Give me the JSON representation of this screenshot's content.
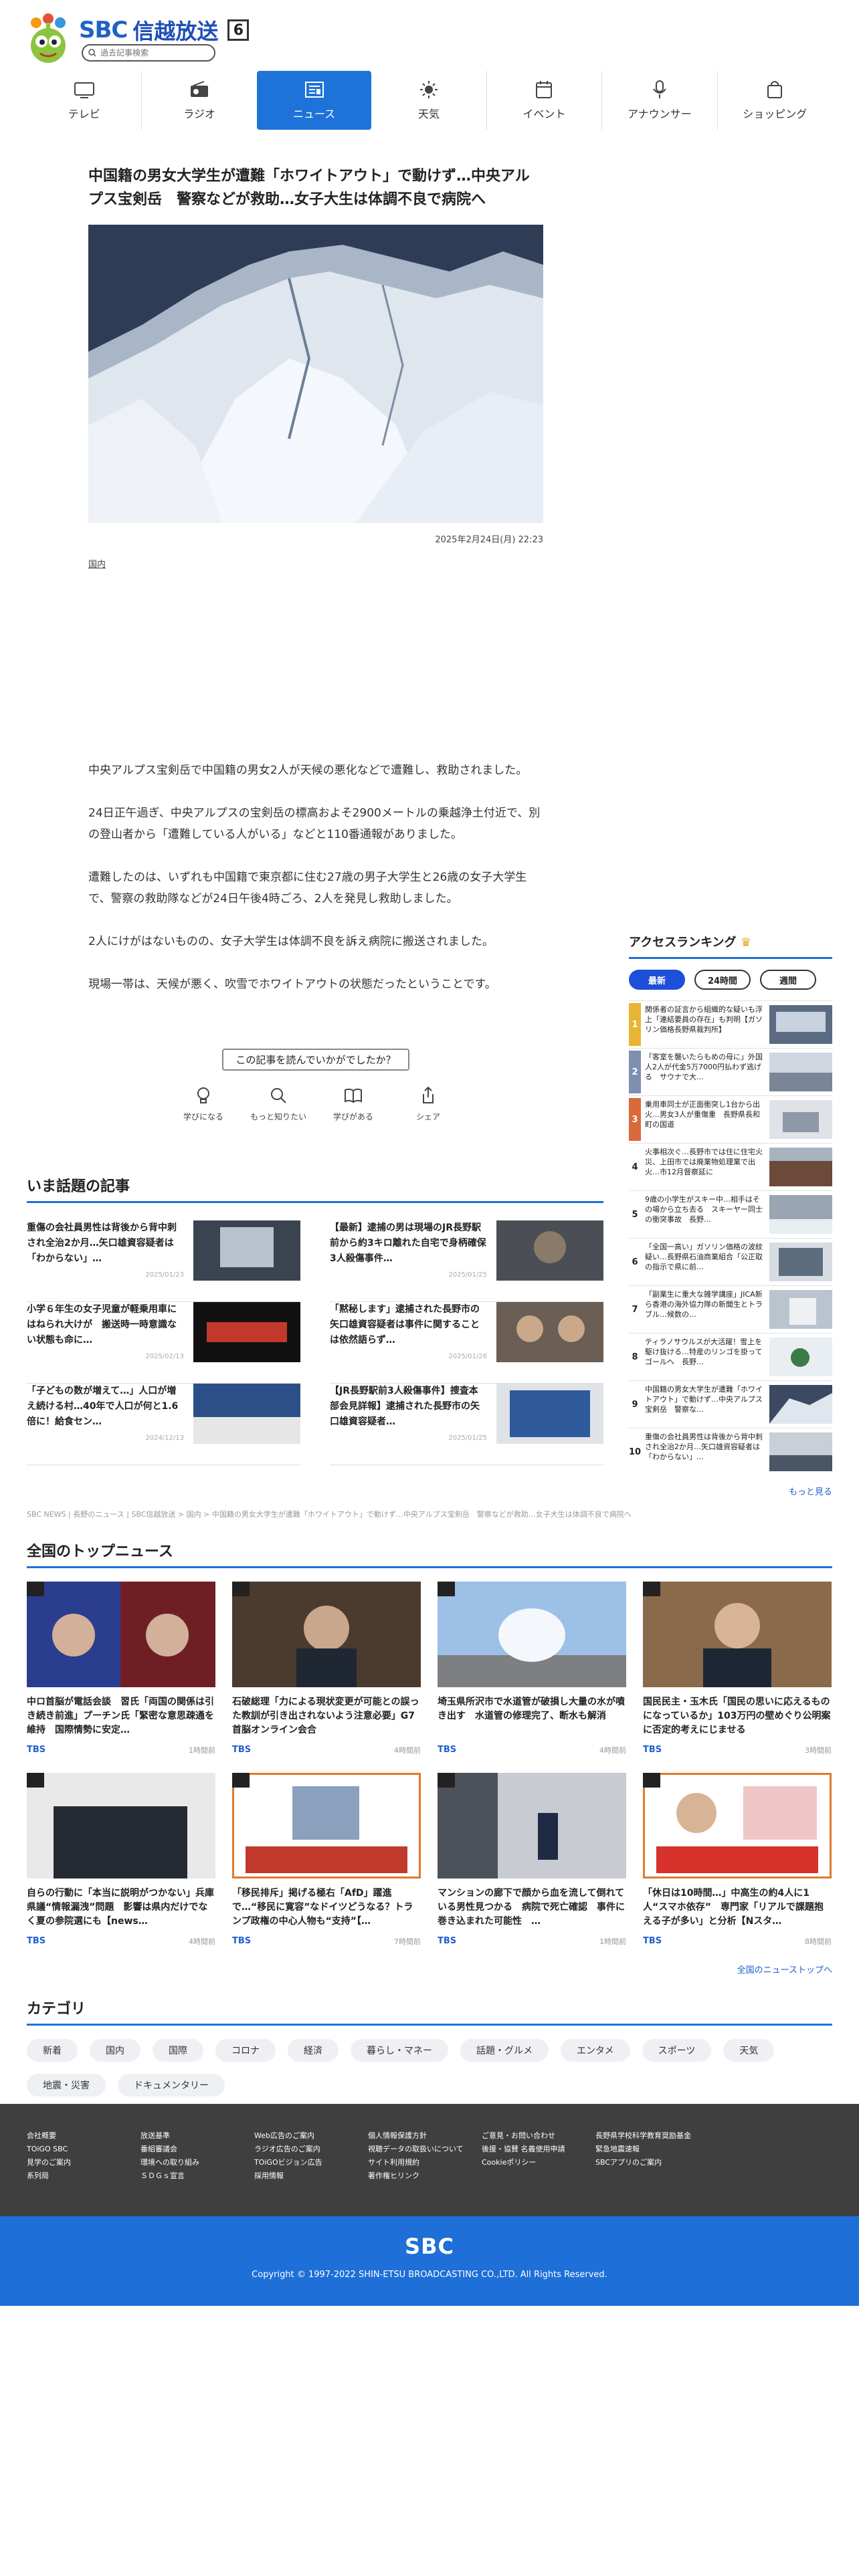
{
  "header": {
    "logo_mark": "SBC",
    "logo_name": "信越放送",
    "channel": "6",
    "search_placeholder": "過去記事検索"
  },
  "nav": [
    {
      "label": "テレビ",
      "icon": "tv-icon"
    },
    {
      "label": "ラジオ",
      "icon": "radio-icon"
    },
    {
      "label": "ニュース",
      "icon": "news-icon",
      "active": true
    },
    {
      "label": "天気",
      "icon": "sun-icon"
    },
    {
      "label": "イベント",
      "icon": "calendar-icon"
    },
    {
      "label": "アナウンサー",
      "icon": "microphone-icon"
    },
    {
      "label": "ショッピング",
      "icon": "shopping-bag-icon"
    }
  ],
  "article": {
    "title": "中国籍の男女大学生が遭難「ホワイトアウト」で動けず…中央アルプス宝剣岳　警察などが救助…女子大生は体調不良で病院へ",
    "date": "2025年2月24日(月) 22:23",
    "category": "国内",
    "paragraphs": [
      "中央アルプス宝剣岳で中国籍の男女2人が天候の悪化などで遭難し、救助されました。",
      "24日正午過ぎ、中央アルプスの宝剣岳の標高およそ2900メートルの乗越浄土付近で、別の登山者から「遭難している人がいる」などと110番通報がありました。",
      "遭難したのは、いずれも中国籍で東京都に住む27歳の男子大学生と26歳の女子大学生で、警察の救助隊などが24日午後4時ごろ、2人を発見し救助しました。",
      "2人にけがはないものの、女子大学生は体調不良を訴え病院に搬送されました。",
      "現場一帯は、天候が悪く、吹雪でホワイトアウトの状態だったということです。"
    ]
  },
  "feedback": {
    "question": "この記事を読んでいかがでしたか？",
    "reactions": [
      {
        "label": "学びになる",
        "icon": "lightbulb-icon"
      },
      {
        "label": "もっと知りたい",
        "icon": "magnifier-icon"
      },
      {
        "label": "学びがある",
        "icon": "book-icon"
      },
      {
        "label": "シェア",
        "icon": "share-icon"
      }
    ]
  },
  "ranking": {
    "title": "アクセスランキング",
    "tabs": [
      "最新",
      "24時間",
      "週間"
    ],
    "items": [
      {
        "num": "1",
        "text": "関係者の証言から組織的な疑いも浮上「連結要員の存在」も判明【ガソリン価格長野県裁判所】"
      },
      {
        "num": "2",
        "text": "「客室を襲いたらもめの母に」外国人2人が代金5万7000円払わず逃げる　サウナで大…"
      },
      {
        "num": "3",
        "text": "乗用車同士が正面衝突し1台から出火…男女3人が重傷重　長野県長和町の国道"
      },
      {
        "num": "4",
        "text": "火事相次ぐ…長野市では住に住宅火災、上田市では廃業物処理業で出火…市12月督察延に"
      },
      {
        "num": "5",
        "text": "9歳の小学生がスキー中…相手はその場から立ち去る　スキーヤー同士の衝突事故　長野…"
      },
      {
        "num": "6",
        "text": "「全国一高い」ガソリン価格の波紋疑い…長野県石油商業組合「公正取の指示で県に前…"
      },
      {
        "num": "7",
        "text": "「副業生に重大な雑学講座」JICA新ら香港の海外協力隊の新聞生とトラブル…候数の…"
      },
      {
        "num": "8",
        "text": "ティラノサウルスが大活躍！雪上を駆け抜ける…特産のリンゴを掛ってゴールへ　長野…"
      },
      {
        "num": "9",
        "text": "中国籍の男女大学生が遭難「ホワイトアウト」で動けず…中央アルプス宝剣岳　警察な…"
      },
      {
        "num": "10",
        "text": "重傷の会社員男性は背後から背中刺され全治2か月…矢口雄資容疑者は「わからない」…"
      }
    ],
    "more": "もっと見る"
  },
  "hot": {
    "title": "いま話題の記事",
    "items": [
      {
        "text": "重傷の会社員男性は背後から背中刺され全治2か月…矢口雄資容疑者は「わからない」…",
        "date": "2025/01/23"
      },
      {
        "text": "【最新】逮捕の男は現場のJR長野駅前から約3キロ離れた自宅で身柄確保　3人殺傷事件…",
        "date": "2025/01/25"
      },
      {
        "text": "小学６年生の女子児童が軽乗用車にはねられ大けが　搬送時一時意識ない状態も命に…",
        "date": "2025/02/13"
      },
      {
        "text": "「黙秘します」逮捕された長野市の矢口雄資容疑者は事件に関することは依然語らず…",
        "date": "2025/01/26"
      },
      {
        "text": "「子どもの数が増えて…」人口が増え続ける村…40年で人口が何と1.6倍に！給食セン…",
        "date": "2024/12/13"
      },
      {
        "text": "【JR長野駅前3人殺傷事件】捜査本部会見詳報】逮捕された長野市の矢口雄資容疑者…",
        "date": "2025/01/25"
      }
    ]
  },
  "breadcrumb": "SBC NEWS | 長野のニュース | SBC信越放送 > 国内 > 中国籍の男女大学生が遭難「ホワイトアウト」で動けず…中央アルプス宝剣岳　警察などが救助…女子大生は体調不良で病院へ",
  "top": {
    "title": "全国のトップニュース",
    "items": [
      {
        "text": "中ロ首脳が電話会談　習氏「両国の関係は引き続き前進」プーチン氏「緊密な意思疎通を維持　国際情勢に安定…",
        "src": "TBS",
        "ago": "1時間前"
      },
      {
        "text": "石破総理「力による現状変更が可能との誤った教訓が引き出されないよう注意必要」G7首脳オンライン会合",
        "src": "TBS",
        "ago": "4時間前"
      },
      {
        "text": "埼玉県所沢市で水道管が破損し大量の水が噴き出す　水道管の修理完了、断水も解消",
        "src": "TBS",
        "ago": "4時間前"
      },
      {
        "text": "国民民主・玉木氏「国民の思いに応えるものになっているか」103万円の壁めぐり公明案に否定的考えにじませる",
        "src": "TBS",
        "ago": "3時間前"
      },
      {
        "text": "自らの行動に「本当に説明がつかない」兵庫県議“情報漏洩”問題　影響は県内だけでなく夏の参院選にも【news…",
        "src": "TBS",
        "ago": "4時間前"
      },
      {
        "text": "「移民排斥」掲げる極右「AfD」躍進で…“移民に寛容”なドイツどうなる？トランプ政権の中心人物も“支持”【…",
        "src": "TBS",
        "ago": "7時間前"
      },
      {
        "text": "マンションの廊下で顔から血を流して倒れている男性見つかる　病院で死亡確認　事件に巻き込まれた可能性　…",
        "src": "TBS",
        "ago": "1時間前"
      },
      {
        "text": "「休日は10時間…」中高生の約4人に1人“スマホ依存”　専門家「リアルで課題抱える子が多い」と分析【Nスタ…",
        "src": "TBS",
        "ago": "8時間前"
      }
    ],
    "more": "全国のニューストップへ"
  },
  "categories": {
    "title": "カテゴリ",
    "items": [
      "新着",
      "国内",
      "国際",
      "コロナ",
      "経済",
      "暮らし・マネー",
      "話題・グルメ",
      "エンタメ",
      "スポーツ",
      "天気",
      "地震・災害",
      "ドキュメンタリー"
    ]
  },
  "footer": {
    "columns": [
      [
        "会社概要",
        "TOiGO SBC",
        "見学のご案内",
        "系列局"
      ],
      [
        "放送基準",
        "番組審議会",
        "環境への取り組み",
        "ＳＤＧｓ宣言"
      ],
      [
        "Web広告のご案内",
        "ラジオ広告のご案内",
        "TOiGOビジョン広告",
        "採用情報"
      ],
      [
        "個人情報保護方針",
        "視聴データの取扱いについて",
        "サイト利用規約",
        "著作権ヒリンク"
      ],
      [
        "ご意見・お問い合わせ",
        "後援・協賛 名義使用申請",
        "Cookieポリシー"
      ],
      [
        "長野県学校科学教育奨励基金",
        "緊急地震速報",
        "SBCアプリのご案内"
      ]
    ],
    "logo": "SBC",
    "copyright": "Copyright © 1997-2022 SHIN-ETSU BROADCASTING CO.,LTD. All Rights Reserved."
  },
  "colors": {
    "accent": "#1e73d8",
    "footer_dark": "#3f3f3f",
    "footer_blue": "#1e6fd8",
    "rank_gold": "#e8b534"
  }
}
